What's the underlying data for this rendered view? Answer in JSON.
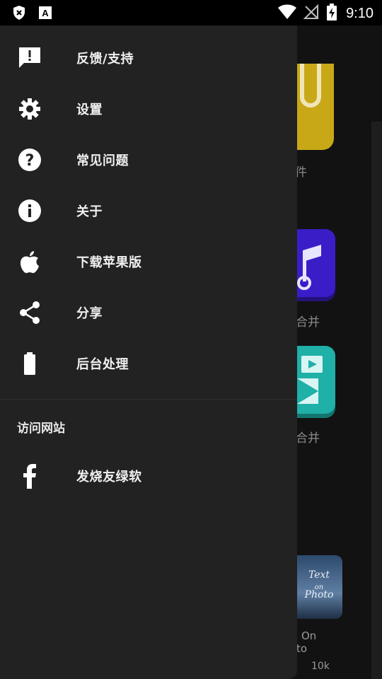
{
  "status_bar": {
    "time": "9:10",
    "icons": [
      "shield-x-icon",
      "font-a-icon",
      "wifi-icon",
      "no-signal-icon",
      "battery-charging-icon"
    ]
  },
  "drawer": {
    "items": [
      {
        "label": "反馈/支持",
        "icon": "feedback-icon"
      },
      {
        "label": "设置",
        "icon": "gear-icon"
      },
      {
        "label": "常见问题",
        "icon": "help-icon"
      },
      {
        "label": "关于",
        "icon": "info-icon"
      },
      {
        "label": "下载苹果版",
        "icon": "apple-icon"
      },
      {
        "label": "分享",
        "icon": "share-icon"
      },
      {
        "label": "后台处理",
        "icon": "battery-icon"
      }
    ],
    "section_title": "访问网站",
    "links": [
      {
        "label": "发烧友绿软",
        "icon": "facebook-icon"
      }
    ]
  },
  "background": {
    "labels": [
      "件",
      "合并",
      "合并",
      "On",
      "to",
      "10k"
    ],
    "photo_tile_text": [
      "Text",
      "on",
      "Photo"
    ]
  }
}
